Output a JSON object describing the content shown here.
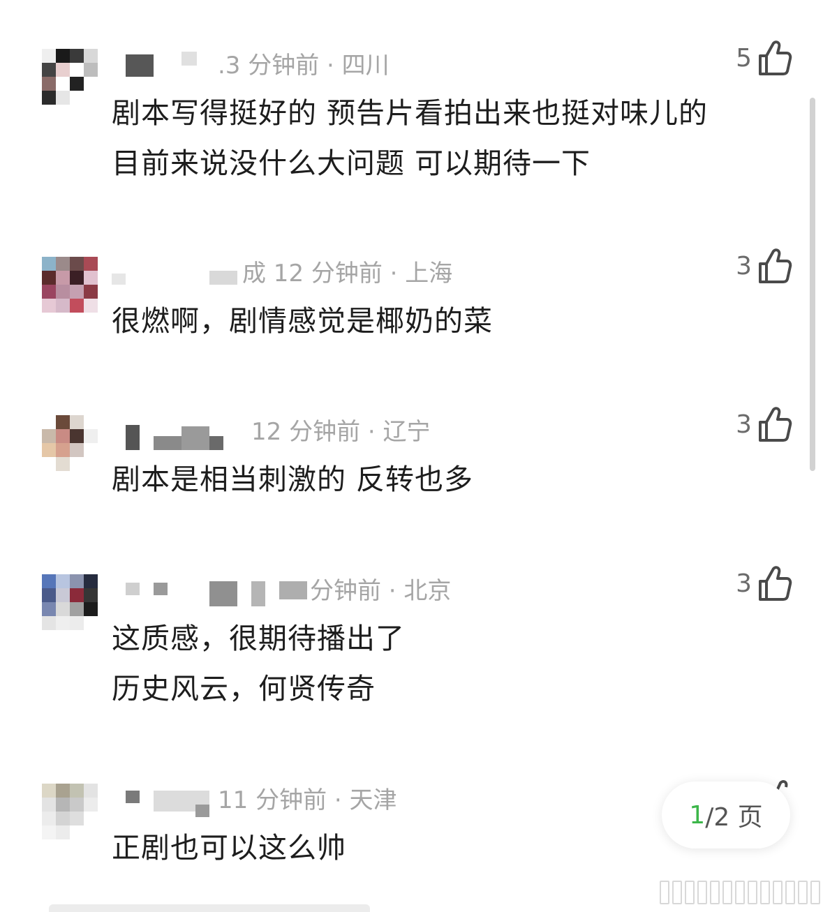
{
  "comments": [
    {
      "meta_partial": ".3 分钟前 · 四川",
      "likes": "5",
      "lines": [
        "剧本写得挺好的 预告片看拍出来也挺对味儿的",
        "目前来说没什么大问题 可以期待一下"
      ],
      "avatar_colors": [
        "#efefef",
        "#1a1a1a",
        "#3a3a3a",
        "#d8d8d8",
        "#444444",
        "#e8cfcf",
        "#ffffff",
        "#bdbdbd",
        "#8a6b68",
        "#ffffff",
        "#222222",
        "#ffffff",
        "#2b2b2b",
        "#e6e6e6",
        "#ffffff",
        "#ffffff"
      ]
    },
    {
      "meta_partial": "成 12 分钟前 · 上海",
      "likes": "3",
      "lines": [
        "很燃啊，剧情感觉是椰奶的菜"
      ],
      "avatar_colors": [
        "#8cb3c9",
        "#9b8a8a",
        "#6b4b4b",
        "#a94a55",
        "#5b2b2b",
        "#c79aa8",
        "#3b1f25",
        "#e1c1cf",
        "#9a4560",
        "#b88ea0",
        "#c5a0b1",
        "#8b3a45",
        "#e6c9d5",
        "#d6b9c9",
        "#c24d5c",
        "#efdfe6"
      ]
    },
    {
      "meta_partial": "12 分钟前 · 辽宁",
      "likes": "3",
      "lines": [
        "剧本是相当刺激的 反转也多"
      ],
      "avatar_colors": [
        "#ffffff",
        "#6b4a3a",
        "#ddd6cf",
        "#ffffff",
        "#c9b9aa",
        "#c98b84",
        "#4a3530",
        "#efefef",
        "#e5c7a7",
        "#d6a18e",
        "#d2c6c1",
        "#ffffff",
        "#ffffff",
        "#e3dcd2",
        "#ffffff",
        "#ffffff"
      ]
    },
    {
      "meta_partial": "分钟前 · 北京",
      "likes": "3",
      "lines": [
        "这质感，很期待播出了",
        "历史风云，何贤传奇"
      ],
      "avatar_colors": [
        "#5676b9",
        "#b8c5e0",
        "#8b93ae",
        "#262c3f",
        "#4a5a8a",
        "#c9c9d6",
        "#8b2a3a",
        "#363636",
        "#7987b0",
        "#d9d9d9",
        "#a0a0a0",
        "#1c1c1c",
        "#e4e4e4",
        "#efefef",
        "#ececec",
        "#ffffff"
      ]
    },
    {
      "meta_partial": "11 分钟前 · 天津",
      "likes": "",
      "lines": [
        "正剧也可以这么帅"
      ],
      "avatar_colors": [
        "#dcd7c6",
        "#a9a290",
        "#c2c2b2",
        "#e3e3e3",
        "#e3e3e3",
        "#b6b6b6",
        "#c9c9c9",
        "#ececec",
        "#ececec",
        "#d4d4d4",
        "#dedede",
        "#ffffff",
        "#f4f4f4",
        "#ececec",
        "#ffffff",
        "#ffffff"
      ]
    }
  ],
  "pager": {
    "current": "1",
    "rest": "/2 页"
  },
  "icons": {
    "like": "thumbs-up-icon"
  }
}
